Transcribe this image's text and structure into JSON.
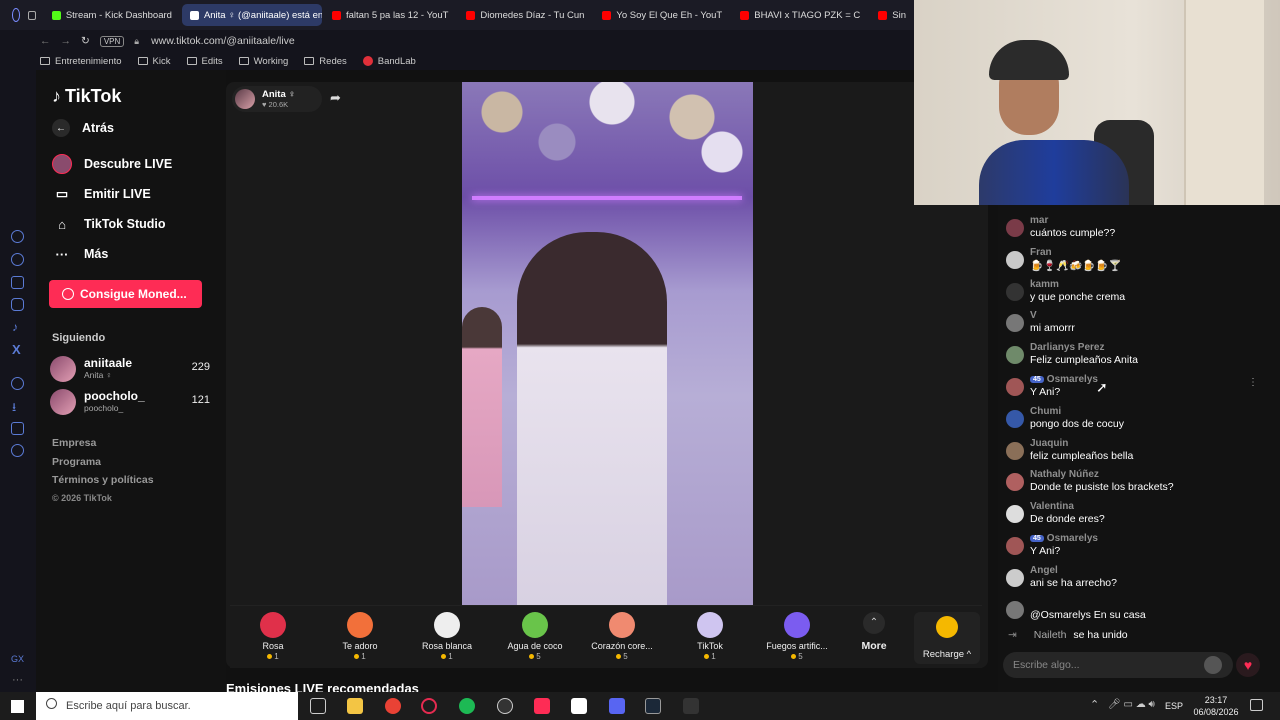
{
  "browser": {
    "tabs": [
      {
        "label": "Stream - Kick Dashboard",
        "icon": "kick-icon",
        "color": "#53fc18"
      },
      {
        "label": "Anita ♀ (@aniitaale) está en",
        "icon": "tiktok-icon",
        "color": "#ffffff",
        "active": true
      },
      {
        "label": "faltan 5 pa las 12 - YouT",
        "icon": "youtube-icon",
        "color": "#ff0000"
      },
      {
        "label": "Diomedes Díaz - Tu Cun",
        "icon": "youtube-icon",
        "color": "#ff0000"
      },
      {
        "label": "Yo Soy El Que Eh - YouT",
        "icon": "youtube-icon",
        "color": "#ff0000"
      },
      {
        "label": "BHAVI x TIAGO PZK = C",
        "icon": "youtube-icon",
        "color": "#ff0000"
      },
      {
        "label": "Sin",
        "icon": "youtube-icon",
        "color": "#ff0000"
      }
    ],
    "vpn_label": "VPN",
    "url": "www.tiktok.com/@aniitaale/live",
    "bookmarks": [
      {
        "label": "Entretenimiento",
        "type": "folder"
      },
      {
        "label": "Kick",
        "type": "folder"
      },
      {
        "label": "Edits",
        "type": "folder"
      },
      {
        "label": "Working",
        "type": "folder"
      },
      {
        "label": "Redes",
        "type": "folder"
      },
      {
        "label": "BandLab",
        "type": "site"
      }
    ]
  },
  "sidebar": {
    "logo": "TikTok",
    "back_label": "Atrás",
    "nav": [
      {
        "label": "Descubre LIVE",
        "icon": "live-avatar-icon"
      },
      {
        "label": "Emitir LIVE",
        "icon": "camera-icon"
      },
      {
        "label": "TikTok Studio",
        "icon": "home-icon"
      },
      {
        "label": "Más",
        "icon": "more-icon"
      }
    ],
    "coins_button": "Consigue Moned...",
    "following_title": "Siguiendo",
    "following": [
      {
        "name": "aniitaale",
        "sub": "Anita ♀",
        "count": "229"
      },
      {
        "name": "poocholo_",
        "sub": "poocholo_",
        "count": "121"
      }
    ],
    "footer": [
      "Empresa",
      "Programa",
      "Términos y políticas",
      "© 2026 TikTok"
    ]
  },
  "stream": {
    "host_name": "Anita ♀",
    "host_likes": "♥ 20.6K"
  },
  "gifts": [
    {
      "name": "Rosa",
      "price": "1",
      "icon": "rose-icon",
      "color": "#e0304a"
    },
    {
      "name": "Te adoro",
      "price": "1",
      "icon": "heart-face-icon",
      "color": "#f2703a"
    },
    {
      "name": "Rosa blanca",
      "price": "1",
      "icon": "white-rose-icon",
      "color": "#eeeeee"
    },
    {
      "name": "Agua de coco",
      "price": "5",
      "icon": "coconut-icon",
      "color": "#69c44a"
    },
    {
      "name": "Corazón core...",
      "price": "5",
      "icon": "hand-heart-icon",
      "color": "#f08a70"
    },
    {
      "name": "TikTok",
      "price": "1",
      "icon": "tiktok-gift-icon",
      "color": "#cfc5f0"
    },
    {
      "name": "Fuegos artific...",
      "price": "5",
      "icon": "fireworks-icon",
      "color": "#7b5cf0"
    }
  ],
  "more_label": "More",
  "recharge_label": "Recharge ^",
  "recommended_title": "Emisiones LIVE recomendadas",
  "chat": {
    "messages": [
      {
        "user": "mar",
        "text": "cuántos cumple??",
        "avatar": "#7a3b48"
      },
      {
        "user": "Fran",
        "text": "🍺🍷🥂🍻🍺🍺🍸",
        "avatar": "#c9c9c9",
        "badge": ""
      },
      {
        "user": "kamm",
        "text": "y que ponche crema",
        "avatar": "#333333"
      },
      {
        "user": "V",
        "text": "mi amorrr",
        "avatar": "#777777"
      },
      {
        "user": "Darlianys Perez",
        "text": "Feliz cumpleaños Anita",
        "avatar": "#6f8a6a"
      },
      {
        "user": "Osmarelys",
        "text": "Y Ani?",
        "avatar": "#a05656",
        "badge": "45"
      },
      {
        "user": "Chumi",
        "text": "pongo dos de cocuy",
        "avatar": "#3558a8"
      },
      {
        "user": "Juaquin",
        "text": "feliz cumpleaños bella",
        "avatar": "#8a6f58"
      },
      {
        "user": "Nathaly Núñez",
        "text": "Donde te pusiste los brackets?",
        "avatar": "#b06060"
      },
      {
        "user": "Valentina",
        "text": "De donde eres?",
        "avatar": "#dddddd"
      },
      {
        "user": "Osmarelys",
        "text": "Y Ani?",
        "avatar": "#a05656",
        "badge": "45"
      },
      {
        "user": "Angel",
        "text": "ani se ha arrecho?",
        "avatar": "#cccccc"
      },
      {
        "user": "",
        "text": "@Osmarelys En su casa",
        "avatar": "#777777"
      }
    ],
    "join_user": "Naileth",
    "join_text": "se ha unido",
    "input_placeholder": "Escribe algo..."
  },
  "taskbar": {
    "search_placeholder": "Escribe aquí para buscar.",
    "lang": "ESP",
    "time": "23:17",
    "date": "06/08/2026"
  }
}
